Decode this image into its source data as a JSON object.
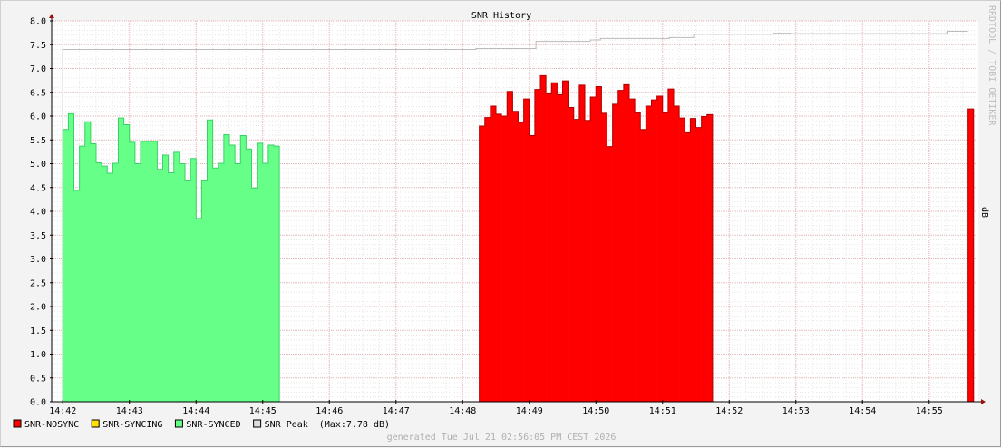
{
  "chart_data": {
    "type": "area",
    "title": "SNR History",
    "ylabel": "dB",
    "watermark": "RRDTOOL / TOBI OETIKER",
    "footer": "generated Tue Jul 21 02:56:05 PM CEST 2026",
    "ylim": [
      0,
      8
    ],
    "yticks": [
      "0.0",
      "0.5",
      "1.0",
      "1.5",
      "2.0",
      "2.5",
      "3.0",
      "3.5",
      "4.0",
      "4.5",
      "5.0",
      "5.5",
      "6.0",
      "6.5",
      "7.0",
      "7.5",
      "8.0"
    ],
    "xticks": [
      "14:42",
      "14:43",
      "14:44",
      "14:45",
      "14:46",
      "14:47",
      "14:48",
      "14:49",
      "14:50",
      "14:51",
      "14:52",
      "14:53",
      "14:54",
      "14:55"
    ],
    "grid": true,
    "legend_position": "bottom-left",
    "legend": [
      {
        "name": "SNR-NOSYNC",
        "color": "#ff0000"
      },
      {
        "name": "SNR-SYNCING",
        "color": "#ffe000"
      },
      {
        "name": "SNR-SYNCED",
        "color": "#66ff88"
      },
      {
        "name": "SNR Peak",
        "color": "#dddddd",
        "suffix": "(Max:7.78 dB)"
      }
    ],
    "series": [
      {
        "name": "SNR-SYNCED",
        "color": "#66ff88",
        "x_start": "14:42:00",
        "step_seconds": 5,
        "values": [
          5.72,
          6.05,
          4.44,
          5.37,
          5.88,
          5.42,
          5.02,
          4.95,
          4.8,
          5.01,
          5.96,
          5.82,
          5.45,
          5.0,
          5.47,
          5.47,
          5.47,
          4.88,
          5.18,
          4.81,
          5.24,
          5.0,
          4.64,
          5.11,
          3.85,
          4.64,
          5.92,
          4.91,
          5.01,
          5.61,
          5.39,
          5.0,
          5.59,
          5.31,
          4.49,
          5.43,
          5.01,
          5.39,
          5.37
        ]
      },
      {
        "name": "SNR-NOSYNC",
        "color": "#ff0000",
        "x_start": "14:48:15",
        "step_seconds": 5,
        "values": [
          5.79,
          5.97,
          6.21,
          6.04,
          6.0,
          6.52,
          6.1,
          5.87,
          6.36,
          5.59,
          6.56,
          6.85,
          6.47,
          6.7,
          6.45,
          6.74,
          6.18,
          5.93,
          6.65,
          5.91,
          6.4,
          6.62,
          6.06,
          5.36,
          6.25,
          6.54,
          6.66,
          6.36,
          6.07,
          5.72,
          6.21,
          6.34,
          6.42,
          6.07,
          6.57,
          6.21,
          5.96,
          5.65,
          5.95,
          5.76,
          5.99,
          6.03
        ]
      },
      {
        "name": "SNR-NOSYNC",
        "color": "#ff0000",
        "x_start": "14:55:35",
        "step_seconds": 5,
        "values": [
          6.15
        ]
      },
      {
        "name": "SNR Peak",
        "color": "#bbbbbb",
        "type": "step-line",
        "points": [
          [
            "14:42:00",
            7.4
          ],
          [
            "14:48:12",
            7.42
          ],
          [
            "14:49:06",
            7.57
          ],
          [
            "14:49:55",
            7.6
          ],
          [
            "14:50:04",
            7.63
          ],
          [
            "14:51:06",
            7.65
          ],
          [
            "14:51:28",
            7.72
          ],
          [
            "14:52:40",
            7.74
          ],
          [
            "14:52:55",
            7.73
          ],
          [
            "14:55:16",
            7.78
          ],
          [
            "14:55:35",
            7.78
          ]
        ]
      }
    ]
  }
}
